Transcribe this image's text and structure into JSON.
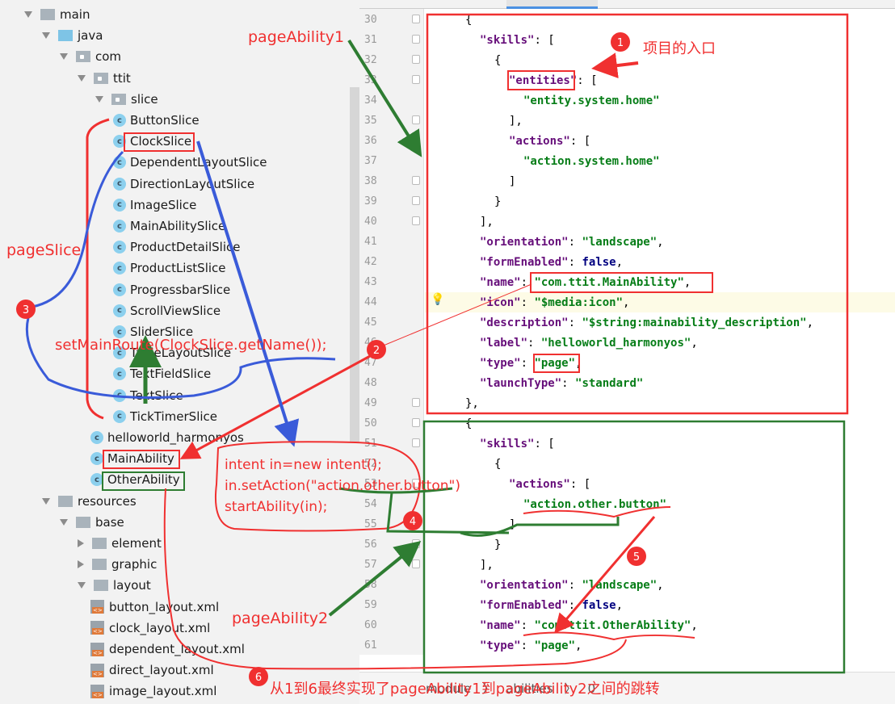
{
  "tree": [
    {
      "label": "main",
      "level": 0,
      "kind": "folder",
      "open": true
    },
    {
      "label": "java",
      "level": 1,
      "kind": "folder-blue",
      "open": true
    },
    {
      "label": "com",
      "level": 2,
      "kind": "package",
      "open": true
    },
    {
      "label": "ttit",
      "level": 3,
      "kind": "package",
      "open": true
    },
    {
      "label": "slice",
      "level": 4,
      "kind": "package",
      "open": true
    },
    {
      "label": "ButtonSlice",
      "level": 5,
      "kind": "class"
    },
    {
      "label": "ClockSlice",
      "level": 5,
      "kind": "class"
    },
    {
      "label": "DependentLayoutSlice",
      "level": 5,
      "kind": "class"
    },
    {
      "label": "DirectionLayoutSlice",
      "level": 5,
      "kind": "class"
    },
    {
      "label": "ImageSlice",
      "level": 5,
      "kind": "class"
    },
    {
      "label": "MainAbilitySlice",
      "level": 5,
      "kind": "class"
    },
    {
      "label": "ProductDetailSlice",
      "level": 5,
      "kind": "class"
    },
    {
      "label": "ProductListSlice",
      "level": 5,
      "kind": "class"
    },
    {
      "label": "ProgressbarSlice",
      "level": 5,
      "kind": "class"
    },
    {
      "label": "ScrollViewSlice",
      "level": 5,
      "kind": "class"
    },
    {
      "label": "SliderSlice",
      "level": 5,
      "kind": "class"
    },
    {
      "label": "TableLayoutSlice",
      "level": 5,
      "kind": "class"
    },
    {
      "label": "TextFieldSlice",
      "level": 5,
      "kind": "class"
    },
    {
      "label": "TextSlice",
      "level": 5,
      "kind": "class"
    },
    {
      "label": "TickTimerSlice",
      "level": 5,
      "kind": "class"
    },
    {
      "label": "helloworld_harmonyos",
      "level": 4,
      "kind": "class"
    },
    {
      "label": "MainAbility",
      "level": 4,
      "kind": "class"
    },
    {
      "label": "OtherAbility",
      "level": 4,
      "kind": "class"
    },
    {
      "label": "resources",
      "level": 1,
      "kind": "folder",
      "open": true
    },
    {
      "label": "base",
      "level": 2,
      "kind": "folder",
      "open": true
    },
    {
      "label": "element",
      "level": 3,
      "kind": "folder",
      "open": false
    },
    {
      "label": "graphic",
      "level": 3,
      "kind": "folder",
      "open": false
    },
    {
      "label": "layout",
      "level": 3,
      "kind": "folder",
      "open": true
    },
    {
      "label": "button_layout.xml",
      "level": 4,
      "kind": "xml"
    },
    {
      "label": "clock_layout.xml",
      "level": 4,
      "kind": "xml"
    },
    {
      "label": "dependent_layout.xml",
      "level": 4,
      "kind": "xml"
    },
    {
      "label": "direct_layout.xml",
      "level": 4,
      "kind": "xml"
    },
    {
      "label": "image_layout.xml",
      "level": 4,
      "kind": "xml"
    }
  ],
  "code": [
    {
      "n": 30,
      "i": 0,
      "t": [
        [
          "p",
          "{"
        ]
      ]
    },
    {
      "n": 31,
      "i": 1,
      "t": [
        [
          "k",
          "\"skills\""
        ],
        [
          "p",
          ": ["
        ]
      ]
    },
    {
      "n": 32,
      "i": 2,
      "t": [
        [
          "p",
          "{"
        ]
      ]
    },
    {
      "n": 33,
      "i": 3,
      "t": [
        [
          "k",
          "\"entities\""
        ],
        [
          "p",
          ": ["
        ]
      ]
    },
    {
      "n": 34,
      "i": 4,
      "t": [
        [
          "s",
          "\"entity.system.home\""
        ]
      ]
    },
    {
      "n": 35,
      "i": 3,
      "t": [
        [
          "p",
          "],"
        ]
      ]
    },
    {
      "n": 36,
      "i": 3,
      "t": [
        [
          "k",
          "\"actions\""
        ],
        [
          "p",
          ": ["
        ]
      ]
    },
    {
      "n": 37,
      "i": 4,
      "t": [
        [
          "s",
          "\"action.system.home\""
        ]
      ]
    },
    {
      "n": 38,
      "i": 3,
      "t": [
        [
          "p",
          "]"
        ]
      ]
    },
    {
      "n": 39,
      "i": 2,
      "t": [
        [
          "p",
          "}"
        ]
      ]
    },
    {
      "n": 40,
      "i": 1,
      "t": [
        [
          "p",
          "],"
        ]
      ]
    },
    {
      "n": 41,
      "i": 1,
      "t": [
        [
          "k",
          "\"orientation\""
        ],
        [
          "p",
          ": "
        ],
        [
          "s",
          "\"landscape\""
        ],
        [
          "p",
          ","
        ]
      ]
    },
    {
      "n": 42,
      "i": 1,
      "t": [
        [
          "k",
          "\"formEnabled\""
        ],
        [
          "p",
          ": "
        ],
        [
          "b",
          "false"
        ],
        [
          "p",
          ","
        ]
      ]
    },
    {
      "n": 43,
      "i": 1,
      "t": [
        [
          "k",
          "\"name\""
        ],
        [
          "p",
          ": "
        ],
        [
          "s",
          "\"com.ttit.MainAbility\""
        ],
        [
          "p",
          ","
        ]
      ]
    },
    {
      "n": 44,
      "i": 1,
      "t": [
        [
          "k",
          "\"icon\""
        ],
        [
          "p",
          ": "
        ],
        [
          "s",
          "\"$media:icon\""
        ],
        [
          "p",
          ","
        ]
      ]
    },
    {
      "n": 45,
      "i": 1,
      "t": [
        [
          "k",
          "\"description\""
        ],
        [
          "p",
          ": "
        ],
        [
          "s",
          "\"$string:mainability_description\""
        ],
        [
          "p",
          ","
        ]
      ]
    },
    {
      "n": 46,
      "i": 1,
      "t": [
        [
          "k",
          "\"label\""
        ],
        [
          "p",
          ": "
        ],
        [
          "s",
          "\"helloworld_harmonyos\""
        ],
        [
          "p",
          ","
        ]
      ]
    },
    {
      "n": 47,
      "i": 1,
      "t": [
        [
          "k",
          "\"type\""
        ],
        [
          "p",
          ": "
        ],
        [
          "s",
          "\"page\""
        ],
        [
          "p",
          ","
        ]
      ]
    },
    {
      "n": 48,
      "i": 1,
      "t": [
        [
          "k",
          "\"launchType\""
        ],
        [
          "p",
          ": "
        ],
        [
          "s",
          "\"standard\""
        ]
      ]
    },
    {
      "n": 49,
      "i": 0,
      "t": [
        [
          "p",
          "},"
        ]
      ]
    },
    {
      "n": 50,
      "i": 0,
      "t": [
        [
          "p",
          "{"
        ]
      ]
    },
    {
      "n": 51,
      "i": 1,
      "t": [
        [
          "k",
          "\"skills\""
        ],
        [
          "p",
          ": ["
        ]
      ]
    },
    {
      "n": 52,
      "i": 2,
      "t": [
        [
          "p",
          "{"
        ]
      ]
    },
    {
      "n": 53,
      "i": 3,
      "t": [
        [
          "k",
          "\"actions\""
        ],
        [
          "p",
          ": ["
        ]
      ]
    },
    {
      "n": 54,
      "i": 4,
      "t": [
        [
          "s",
          "\"action.other.button\""
        ]
      ]
    },
    {
      "n": 55,
      "i": 3,
      "t": [
        [
          "p",
          "]"
        ]
      ]
    },
    {
      "n": 56,
      "i": 2,
      "t": [
        [
          "p",
          "}"
        ]
      ]
    },
    {
      "n": 57,
      "i": 1,
      "t": [
        [
          "p",
          "],"
        ]
      ]
    },
    {
      "n": 58,
      "i": 1,
      "t": [
        [
          "k",
          "\"orientation\""
        ],
        [
          "p",
          ": "
        ],
        [
          "s",
          "\"landscape\""
        ],
        [
          "p",
          ","
        ]
      ]
    },
    {
      "n": 59,
      "i": 1,
      "t": [
        [
          "k",
          "\"formEnabled\""
        ],
        [
          "p",
          ": "
        ],
        [
          "b",
          "false"
        ],
        [
          "p",
          ","
        ]
      ]
    },
    {
      "n": 60,
      "i": 1,
      "t": [
        [
          "k",
          "\"name\""
        ],
        [
          "p",
          ": "
        ],
        [
          "s",
          "\"com.ttit.OtherAbility\""
        ],
        [
          "p",
          ","
        ]
      ]
    },
    {
      "n": 61,
      "i": 1,
      "t": [
        [
          "k",
          "\"type\""
        ],
        [
          "p",
          ": "
        ],
        [
          "s",
          "\"page\""
        ],
        [
          "p",
          ","
        ]
      ]
    }
  ],
  "breadcrumb": [
    "module",
    "abilities",
    "0"
  ],
  "annotations": {
    "page_ability1": "pageAbility1",
    "page_ability2": "pageAbility2",
    "page_slice": "pageSlice",
    "entry_note": "项目的入口",
    "set_main_route": "setMainRoute(ClockSlice.getName());",
    "intent_code": [
      "intent in=new intent();",
      "in.setAction(\"action.other.button\")",
      "startAbility(in);"
    ],
    "summary": "从1到6最终实现了pageAbility1到pageAbility2之间的跳转",
    "steps": [
      "1",
      "2",
      "3",
      "4",
      "5",
      "6"
    ]
  },
  "colors": {
    "annotation_red": "#f03030",
    "annotation_green": "#2e7d32",
    "annotation_blue": "#3a5bd9",
    "key": "#660e7a",
    "string": "#067d17"
  }
}
